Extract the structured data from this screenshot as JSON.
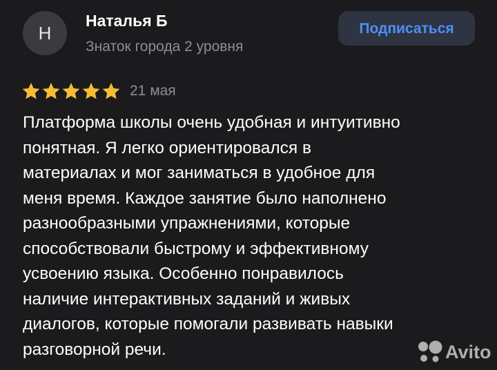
{
  "author": {
    "avatar_letter": "Н",
    "name": "Наталья Б",
    "level": "Знаток города 2 уровня"
  },
  "subscribe_button": {
    "label": "Подписаться"
  },
  "review": {
    "rating": 5,
    "rating_max": 5,
    "star_color": "#f5bd35",
    "date": "21 мая",
    "lines": [
      "Платформа школы очень удобная и интуитивно",
      "понятная. Я легко ориентировался в",
      "материалах и мог заниматься в удобное для",
      "меня время. Каждое занятие было наполнено",
      "разнообразными упражнениями, которые",
      "способствовали быстрому и эффективному",
      "усвоению языка. Особенно понравилось",
      "наличие интерактивных заданий и живых",
      "диалогов, которые помогали развивать навыки",
      "разговорной речи."
    ]
  },
  "watermark": {
    "text": "Avito",
    "icon": "avito-logo-icon"
  },
  "colors": {
    "background": "#1b1b1d",
    "accent": "#4f8ff7",
    "secondary_text": "#8e8e93"
  }
}
